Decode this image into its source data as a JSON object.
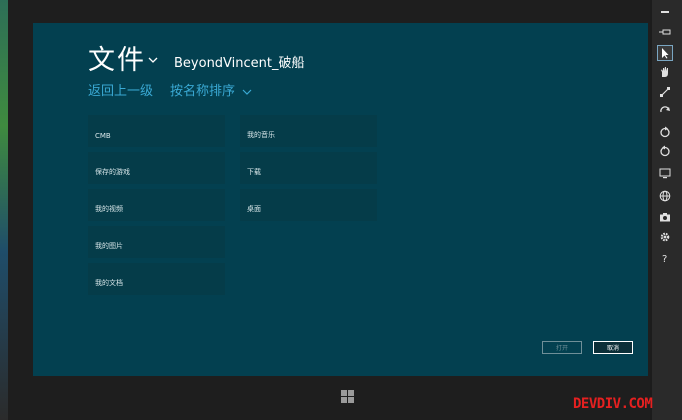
{
  "header": {
    "title": "文件",
    "user": "BeyondVincent_破船"
  },
  "nav": {
    "up": "返回上一级",
    "sort": "按名称排序"
  },
  "folders": [
    "CMB",
    "保存的游戏",
    "我的视频",
    "我的图片",
    "我的文档",
    "我的音乐",
    "下载",
    "桌面"
  ],
  "footer": {
    "open": "打开",
    "cancel": "取消"
  },
  "watermark": "DEVDIV.COM",
  "toolbar_icons": [
    "minimize-icon",
    "pin-icon",
    "pointer-icon",
    "hand-icon",
    "pinch-icon",
    "rotate-icon",
    "rotate-cw-icon",
    "rotate-ccw-icon",
    "display-icon",
    "globe-icon",
    "camera-icon",
    "settings-icon",
    "help-icon"
  ],
  "colors": {
    "screen": "#034050",
    "tile": "#053c49",
    "accent": "#3aa9d4",
    "watermark": "#e52020"
  }
}
